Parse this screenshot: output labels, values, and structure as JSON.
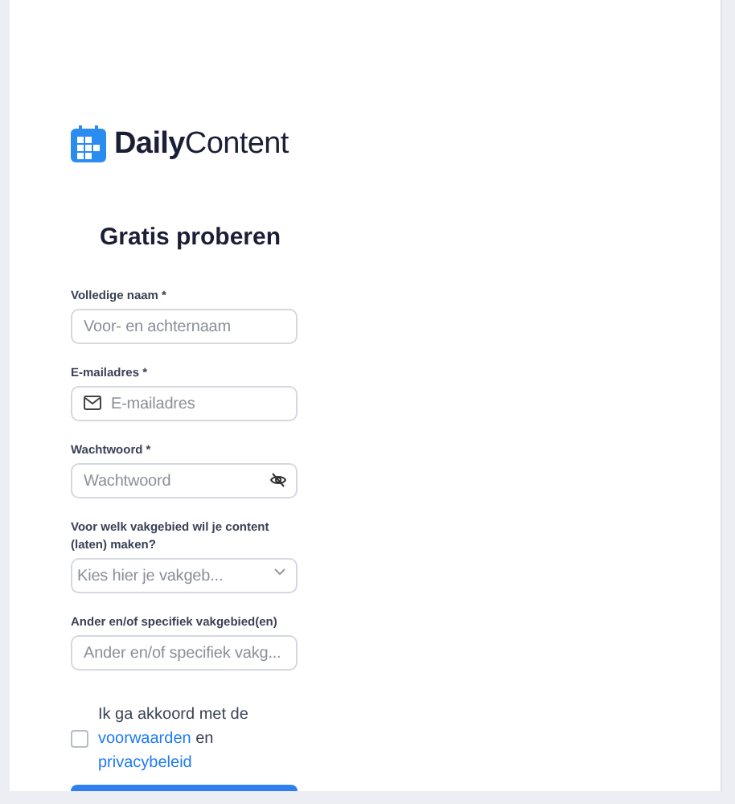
{
  "logo": {
    "text_bold": "Daily",
    "text_regular": "Content"
  },
  "heading": "Gratis proberen",
  "fields": [
    {
      "kind": "text",
      "label": "Volledige naam *",
      "placeholder": "Voor- en achternaam"
    },
    {
      "kind": "email",
      "label": "E-mailadres *",
      "placeholder": "E-mailadres"
    },
    {
      "kind": "password",
      "label": "Wachtwoord *",
      "placeholder": "Wachtwoord"
    },
    {
      "kind": "select",
      "label": "Voor welk vakgebied wil je content (laten) maken?",
      "placeholder": "Kies hier je vakgeb..."
    },
    {
      "kind": "text",
      "label": "Ander en/of specifiek vakgebied(en)",
      "placeholder": "Ander en/of specifiek vakg..."
    }
  ],
  "consent": {
    "checked": false,
    "text_before": "Ik ga akkoord met de",
    "link_1": "voorwaarden",
    "text_middle": "en",
    "link_2": "privacybeleid"
  }
}
